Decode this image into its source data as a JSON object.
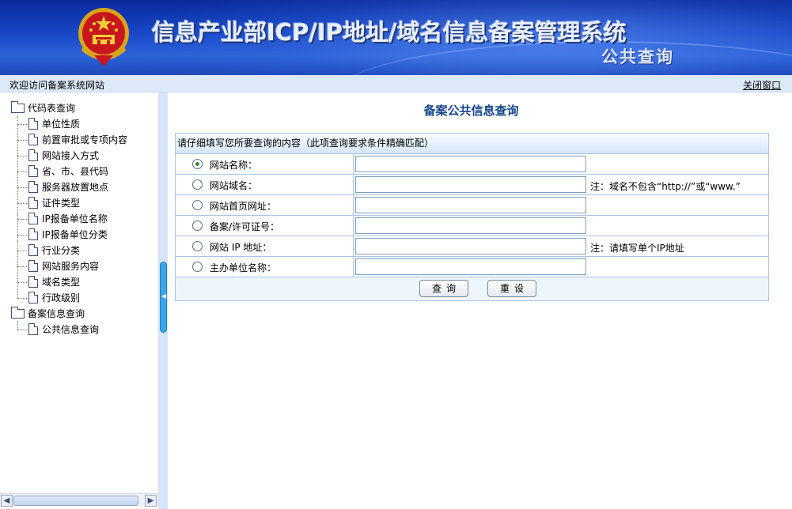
{
  "header": {
    "title": "信息产业部ICP/IP地址/域名信息备案管理系统",
    "subtitle": "公共查询",
    "emblem_icon": "national-emblem-icon"
  },
  "welcome_bar": {
    "welcome_text": "欢迎访问备案系统网站",
    "close_label": "关闭窗口"
  },
  "sidebar": {
    "groups": [
      {
        "label": "代码表查询",
        "items": [
          "单位性质",
          "前置审批或专项内容",
          "网站接入方式",
          "省、市、县代码",
          "服务器放置地点",
          "证件类型",
          "IP报备单位名称",
          "IP报备单位分类",
          "行业分类",
          "网站服务内容",
          "域名类型",
          "行政级别"
        ]
      },
      {
        "label": "备案信息查询",
        "items": [
          "公共信息查询"
        ]
      }
    ]
  },
  "main": {
    "title": "备案公共信息查询",
    "instruction": "请仔细填写您所要查询的内容（此项查询要求条件精确匹配）",
    "fields": [
      {
        "label": "网站名称：",
        "value": "",
        "note": "",
        "selected": true
      },
      {
        "label": "网站域名：",
        "value": "",
        "note": "注：域名不包含“http://”或“www.”",
        "selected": false
      },
      {
        "label": "网站首页网址：",
        "value": "",
        "note": "",
        "selected": false
      },
      {
        "label": "备案/许可证号：",
        "value": "",
        "note": "",
        "selected": false
      },
      {
        "label": "网站 IP 地址：",
        "value": "",
        "note": "注：请填写单个IP地址",
        "selected": false
      },
      {
        "label": "主办单位名称：",
        "value": "",
        "note": "",
        "selected": false
      }
    ],
    "query_label": "查询",
    "reset_label": "重设"
  }
}
